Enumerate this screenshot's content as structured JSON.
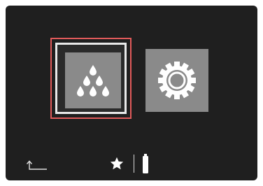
{
  "screen": {
    "background_color": "#1f1f1f",
    "accent_color": "#e05a5a",
    "tile_color": "#8a8a8a"
  },
  "menu": {
    "tiles": [
      {
        "icon": "water-drops-icon",
        "selected": true
      },
      {
        "icon": "gear-icon",
        "selected": false
      }
    ]
  },
  "footer": {
    "icons": [
      "back-arrow-icon",
      "star-icon",
      "battery-icon"
    ]
  }
}
